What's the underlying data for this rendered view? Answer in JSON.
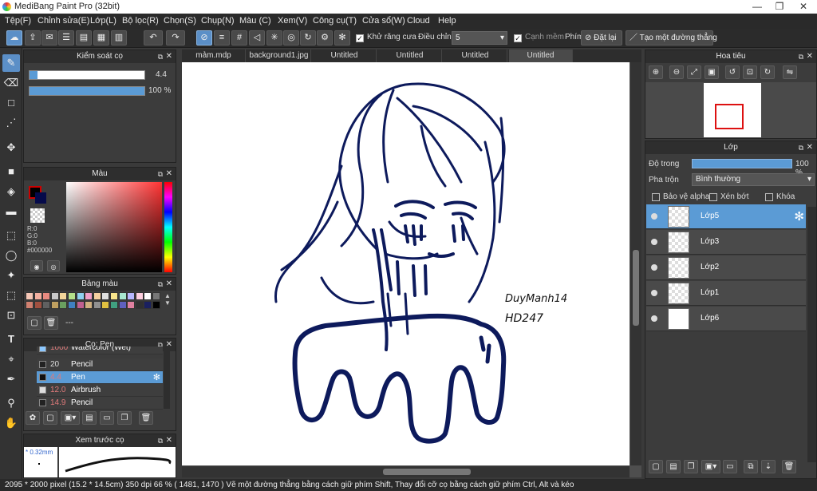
{
  "window": {
    "title": "MediBang Paint Pro (32bit)",
    "minimize": "—",
    "maximize": "❐",
    "close": "✕"
  },
  "menu": [
    "Tệp(F)",
    "Chỉnh sửa(E)",
    "Lớp(L)",
    "Bộ lọc(R)",
    "Chọn(S)",
    "Chụp(N)",
    "Màu (C)",
    "Xem(V)",
    "Công cụ(T)",
    "Cửa sổ(W)",
    "Cloud",
    "Help"
  ],
  "toolbar": {
    "antialias_label": "Khử răng cưa",
    "correction_label": "Điều chỉnh",
    "correction_value": "5",
    "soft_edge_label": "Cạnh mềm",
    "key_label": "Phím",
    "reset_label": "Đặt lại",
    "straight_line_label": "Tạo một đường thẳng"
  },
  "brush_control": {
    "title": "Kiểm soát cọ",
    "size": "4.4",
    "opacity": "100 %",
    "size_fraction": 0.07,
    "opacity_fraction": 1.0
  },
  "color_panel": {
    "title": "Màu",
    "r": "R:0",
    "g": "G:0",
    "b": "B:0",
    "hex": "#000000"
  },
  "palette": {
    "title": "Bảng màu",
    "label": "---"
  },
  "brush_panel": {
    "title": "Cọ: Pen",
    "items": [
      {
        "size": "1000",
        "name": "Watercolor (Wet)",
        "size_color": "#e07a7a",
        "swatch": "#8cc8ff"
      },
      {
        "size": "20",
        "name": "Pencil",
        "size_color": "#dddddd",
        "swatch": "#222222"
      },
      {
        "size": "4.4",
        "name": "Pen",
        "size_color": "#e07a7a",
        "swatch": "#111111",
        "selected": true
      },
      {
        "size": "12.0",
        "name": "Airbrush",
        "size_color": "#e07a7a",
        "swatch": "#dddddd"
      },
      {
        "size": "14.9",
        "name": "Pencil",
        "size_color": "#e07a7a",
        "swatch": "#222222"
      }
    ]
  },
  "preview": {
    "title": "Xem trước cọ",
    "size": "* 0.32mm"
  },
  "tabs": [
    "mảm.mdp",
    "background1.jpg",
    "Untitled",
    "Untitled",
    "Untitled",
    "Untitled"
  ],
  "navigator": {
    "title": "Hoa tiêu"
  },
  "layers_panel": {
    "title": "Lớp",
    "opacity_label": "Độ trong",
    "opacity_value": "100 %",
    "blend_label": "Pha trộn",
    "blend_value": "Bình thường",
    "protect_alpha": "Bảo vệ alpha",
    "clipping": "Xén bớt",
    "lock": "Khóa",
    "layers": [
      "Lớp5",
      "Lớp3",
      "Lớp2",
      "Lớp1",
      "Lớp6"
    ]
  },
  "signature": {
    "line1": "DuyManh14",
    "line2": "HD247"
  },
  "status": {
    "text": "2095 * 2000 pixel   (15.2 * 14.5cm)   350 dpi   66 %   ( 1481, 1470 )   Vẽ một đường thẳng bằng cách giữ phím Shift, Thay đổi cỡ cọ bằng cách giữ phím Ctrl, Alt và kéo"
  },
  "colors": {
    "accent": "#5b9bd5",
    "ink": "#0d1a5c"
  }
}
